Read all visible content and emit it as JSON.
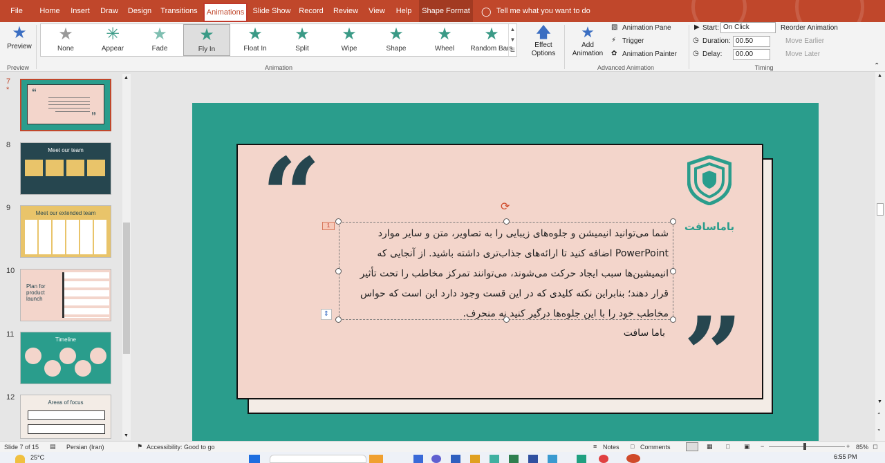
{
  "ribbon_tabs": [
    "File",
    "Home",
    "Insert",
    "Draw",
    "Design",
    "Transitions",
    "Animations",
    "Slide Show",
    "Record",
    "Review",
    "View",
    "Help",
    "Shape Format"
  ],
  "tell_me": "Tell me what you want to do",
  "preview": {
    "label": "Preview",
    "group": "Preview"
  },
  "animations": [
    "None",
    "Appear",
    "Fade",
    "Fly In",
    "Float In",
    "Split",
    "Wipe",
    "Shape",
    "Wheel",
    "Random Bars"
  ],
  "effect_options": [
    "Effect",
    "Options"
  ],
  "animation_group": "Animation",
  "add_animation": [
    "Add",
    "Animation"
  ],
  "advanced": {
    "pane": "Animation Pane",
    "trigger": "Trigger",
    "painter": "Animation Painter",
    "group": "Advanced Animation"
  },
  "timing": {
    "start_label": "Start:",
    "start_value": "On Click",
    "duration_label": "Duration:",
    "duration_value": "00.50",
    "delay_label": "Delay:",
    "delay_value": "00.00",
    "reorder": "Reorder Animation",
    "earlier": "Move Earlier",
    "later": "Move Later",
    "group": "Timing"
  },
  "slides": [
    {
      "num": "7",
      "star": "*",
      "title": ""
    },
    {
      "num": "8",
      "title": "Meet our team"
    },
    {
      "num": "9",
      "title": "Meet our extended team"
    },
    {
      "num": "10",
      "title": "Plan for product launch"
    },
    {
      "num": "11",
      "title": "Timeline"
    },
    {
      "num": "12",
      "title": "Areas of focus"
    }
  ],
  "slide_content": {
    "anim_tag": "1",
    "brand": "باماسافت",
    "lines": [
      "شما می‌توانید انیمیشن و جلوه‌های زیبایی را به تصاویر، متن و سایر موارد",
      "PowerPoint اضافه کنید تا ارائه‌های جذاب‌تری داشته باشید. از آنجایی که",
      "انیمیشین‌ها سبب ایجاد حرکت می‌شوند، می‌توانند تمرکز مخاطب را تحت تأثیر",
      "قرار دهند؛ بنابراین نکته کلیدی که در این قست وجود دارد این است که حواس",
      "مخاطب خود را با این جلوه‌ها درگیر کنید نه منحرف."
    ],
    "author": "باما سافت"
  },
  "status": {
    "slide": "Slide 7 of 15",
    "language": "Persian (Iran)",
    "accessibility": "Accessibility: Good to go",
    "notes": "Notes",
    "comments": "Comments",
    "zoom": "85%"
  },
  "taskbar": {
    "temp": "25°C",
    "time": "6:55 PM"
  },
  "colors": {
    "accent": "#c0472b",
    "slide_bg": "#2a9d8c",
    "card": "#f3d5cb",
    "dark": "#26464f",
    "brand": "#2a9d8c"
  }
}
